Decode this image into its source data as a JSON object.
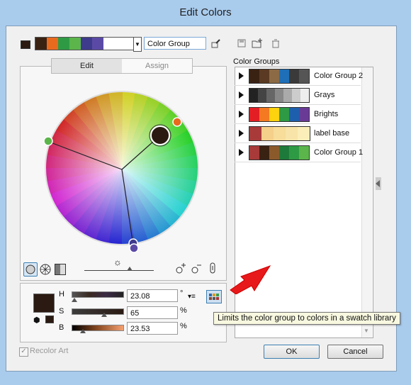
{
  "window": {
    "title": "Edit Colors"
  },
  "top": {
    "active_color": "#2a1a12",
    "strip_colors": [
      "#3a2213",
      "#e86a1f",
      "#2e9a44",
      "#5bb54b",
      "#3e3a8c",
      "#5b4aa5"
    ],
    "group_name_value": "Color Group",
    "new_group_icon": "eyedropper-icon",
    "save_icon": "save-icon",
    "new_folder_icon": "new-group-icon",
    "delete_icon": "trash-icon"
  },
  "tabs": {
    "edit": "Edit",
    "assign": "Assign"
  },
  "wheel": {
    "handles": [
      {
        "name": "base-color-handle",
        "color": "#2a1a12"
      },
      {
        "name": "orange-handle",
        "color": "#e86a1f"
      },
      {
        "name": "green-handle",
        "color": "#5bb54b"
      },
      {
        "name": "blue-handle",
        "color": "#5b4aa5"
      }
    ]
  },
  "wheel_toolbar": {
    "smooth_wheel_icon": "smooth-wheel-icon",
    "segmented_wheel_icon": "segmented-wheel-icon",
    "bars_icon": "color-bars-icon",
    "brightness_icon": "brightness-icon",
    "add_tool_icon": "add-color-tool-icon",
    "remove_tool_icon": "remove-color-tool-icon",
    "link_icon": "link-harmony-icon"
  },
  "hsb": {
    "h_label": "H",
    "h_value": "23.08",
    "h_unit": "°",
    "s_label": "S",
    "s_value": "65",
    "s_unit": "%",
    "b_label": "B",
    "b_value": "23.53",
    "b_unit": "%",
    "current_color": "#2a1a12",
    "menu_icon": "panel-menu-icon",
    "swatch_library_icon": "swatch-library-icon"
  },
  "color_groups": {
    "label": "Color Groups",
    "items": [
      {
        "name": "Color Group 2",
        "colors": [
          "#3a2213",
          "#5a3a22",
          "#8b6a45",
          "#1e6fb8",
          "#3a3a3a",
          "#555555"
        ]
      },
      {
        "name": "Grays",
        "colors": [
          "#222222",
          "#444444",
          "#666666",
          "#888888",
          "#aaaaaa",
          "#cccccc",
          "#eeeeee"
        ]
      },
      {
        "name": "Brights",
        "colors": [
          "#e31e24",
          "#f47920",
          "#fdd20e",
          "#2e9a44",
          "#1d5fad",
          "#6a3b96"
        ]
      },
      {
        "name": "label base",
        "colors": [
          "#a83a3a",
          "#f5d08a",
          "#f7dc9a",
          "#f8e4a8",
          "#fbeeb8"
        ]
      },
      {
        "name": "Color Group 1",
        "colors": [
          "#a83a3a",
          "#3a2213",
          "#8b5a2b",
          "#1e7a3a",
          "#2e9a44",
          "#5bb54b"
        ]
      }
    ]
  },
  "footer": {
    "recolor_art": "Recolor Art",
    "ok": "OK",
    "cancel": "Cancel"
  },
  "tooltip": {
    "text": "Limits the color group to colors in a swatch library"
  },
  "annotation": {
    "arrow_color": "#e8191b"
  }
}
